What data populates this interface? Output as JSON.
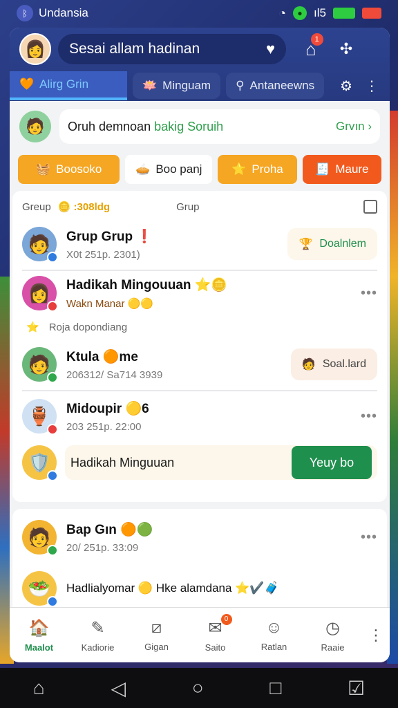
{
  "status_bar": {
    "carrier": "Undansia",
    "carrier_icon": "bluetooth-icon",
    "wifi_icon": "wifi-icon",
    "signal": "ıl5",
    "colors": {
      "battery": "#2ecc40",
      "alert": "#f04a3a"
    }
  },
  "header": {
    "search_text": "Sesai allam hadinan",
    "home_badge": "1"
  },
  "tabs": [
    {
      "label": "Alirg Grin",
      "icon": "heart-icon"
    },
    {
      "label": "Minguam",
      "icon": "gift-icon"
    },
    {
      "label": "Antaneewns",
      "icon": "search-icon"
    }
  ],
  "promo": {
    "text": "Oruh demnoan",
    "highlight": "bakig Soruih",
    "more": "Grvın ›"
  },
  "chips": [
    {
      "label": "Boosoko",
      "icon": "🧺"
    },
    {
      "label": "Boo panj",
      "icon": "🥧"
    },
    {
      "label": "Proha",
      "icon": "⭐"
    },
    {
      "label": "Maure",
      "icon": "🧾"
    }
  ],
  "list_header": {
    "left": "Greup",
    "coin": "🪙 :308ldg",
    "right": "Grup"
  },
  "rows": [
    {
      "title": "Grup Grup",
      "tag": "❗",
      "sub": "X0t 251p. 2301)",
      "action": "Doalnlem",
      "action_icon": "🏆"
    },
    {
      "title": "Hadikah Mingouuan ⭐🪙",
      "sub": "Wakn Manar 🟡🟡",
      "extra": "Roja dopondiang"
    },
    {
      "title": "Ktula 🟠me",
      "sub": "206312/  Sa714 3939",
      "action": "Soal.lard",
      "action_icon": "🧑"
    },
    {
      "title": "Midoupir 🟡6",
      "sub": "203 251p. 22:00"
    }
  ],
  "weekly": {
    "label": "Hadikah Minguuan",
    "button": "Yeuy bo"
  },
  "rows2": [
    {
      "title": "Bap Gın 🟠🟢",
      "sub": "20/ 251p. 33:09"
    },
    {
      "title": "Hadlialyomar 🟡  Hke alamdana ⭐✔️🧳"
    }
  ],
  "bottom_nav": [
    {
      "label": "Maalot",
      "icon": "home-icon",
      "active": true
    },
    {
      "label": "Kadiorie",
      "icon": "edit-icon"
    },
    {
      "label": "Gigan",
      "icon": "chart-icon"
    },
    {
      "label": "Saito",
      "icon": "message-icon",
      "badge": "0"
    },
    {
      "label": "Ratlan",
      "icon": "user-icon"
    },
    {
      "label": "Raaie",
      "icon": "clock-icon"
    }
  ]
}
